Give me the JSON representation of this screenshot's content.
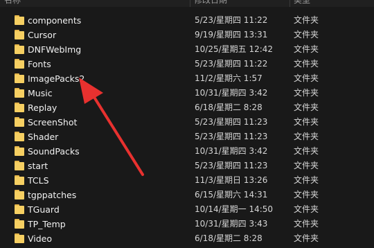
{
  "header": {
    "name_label": "名称",
    "date_label": "修改日期",
    "type_label": "类型"
  },
  "rows": [
    {
      "name": "components",
      "date": "5/23/星期四 11:22",
      "type": "文件夹"
    },
    {
      "name": "Cursor",
      "date": "9/19/星期四 13:31",
      "type": "文件夹"
    },
    {
      "name": "DNFWebImg",
      "date": "10/25/星期五 12:42",
      "type": "文件夹"
    },
    {
      "name": "Fonts",
      "date": "5/23/星期四 11:22",
      "type": "文件夹"
    },
    {
      "name": "ImagePacks2",
      "date": "11/2/星期六 1:57",
      "type": "文件夹"
    },
    {
      "name": "Music",
      "date": "10/31/星期四 3:42",
      "type": "文件夹"
    },
    {
      "name": "Replay",
      "date": "6/18/星期二 8:28",
      "type": "文件夹"
    },
    {
      "name": "ScreenShot",
      "date": "5/23/星期四 11:23",
      "type": "文件夹"
    },
    {
      "name": "Shader",
      "date": "5/23/星期四 11:23",
      "type": "文件夹"
    },
    {
      "name": "SoundPacks",
      "date": "10/31/星期四 3:42",
      "type": "文件夹"
    },
    {
      "name": "start",
      "date": "5/23/星期四 11:23",
      "type": "文件夹"
    },
    {
      "name": "TCLS",
      "date": "11/3/星期日 13:26",
      "type": "文件夹"
    },
    {
      "name": "tgppatches",
      "date": "6/15/星期六 14:31",
      "type": "文件夹"
    },
    {
      "name": "TGuard",
      "date": "10/14/星期一 14:50",
      "type": "文件夹"
    },
    {
      "name": "TP_Temp",
      "date": "10/31/星期四 3:43",
      "type": "文件夹"
    },
    {
      "name": "Video",
      "date": "6/18/星期二 8:28",
      "type": "文件夹"
    }
  ],
  "colors": {
    "background": "#191919",
    "folder": "#f6cf62",
    "annotation_arrow": "#e8312f"
  },
  "icons": {
    "folder": "folder-icon",
    "annotation": "annotation-arrow"
  }
}
